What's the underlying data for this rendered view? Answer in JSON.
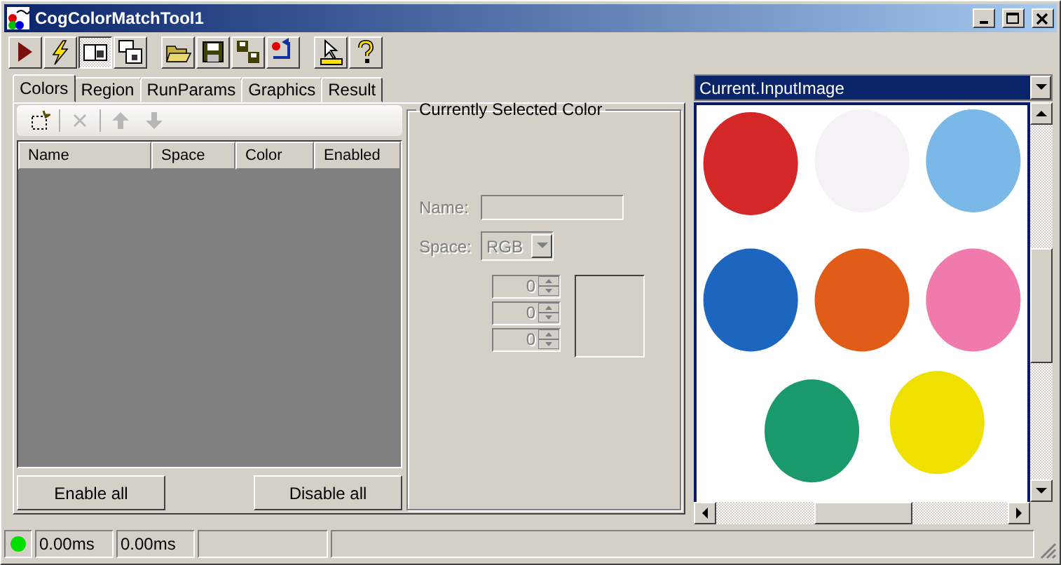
{
  "window": {
    "title": "CogColorMatchTool1"
  },
  "toolbar": [
    {
      "kind": "run",
      "pressed": false
    },
    {
      "kind": "flash",
      "pressed": false
    },
    {
      "kind": "panes",
      "pressed": true
    },
    {
      "kind": "float",
      "pressed": false
    },
    {
      "kind": "open",
      "pressed": false
    },
    {
      "kind": "save",
      "pressed": false
    },
    {
      "kind": "saveas",
      "pressed": false
    },
    {
      "kind": "reset",
      "pressed": false
    },
    {
      "kind": "measure",
      "pressed": false
    },
    {
      "kind": "help",
      "pressed": false
    }
  ],
  "tabs": [
    {
      "label": "Colors",
      "selected": true
    },
    {
      "label": "Region",
      "selected": false
    },
    {
      "label": "RunParams",
      "selected": false
    },
    {
      "label": "Graphics",
      "selected": false
    },
    {
      "label": "Result",
      "selected": false
    }
  ],
  "color_list": {
    "toolbar": [
      {
        "kind": "add",
        "disabled": false
      },
      {
        "kind": "delete",
        "disabled": true
      },
      {
        "kind": "up",
        "disabled": true
      },
      {
        "kind": "down",
        "disabled": true
      }
    ],
    "columns": [
      "Name",
      "Space",
      "Color",
      "Enabled"
    ],
    "buttons": [
      "Enable all",
      "Disable all"
    ]
  },
  "selected_color": {
    "title": "Currently Selected Color",
    "disabled": true,
    "name_label": "Name:",
    "space_label": "Space:",
    "space_value": "RGB",
    "channels": [
      "0",
      "0",
      "0"
    ]
  },
  "image_view": {
    "source": "Current.InputImage"
  },
  "status_bar": {
    "fields": [
      "0.00ms",
      "0.00ms"
    ]
  }
}
